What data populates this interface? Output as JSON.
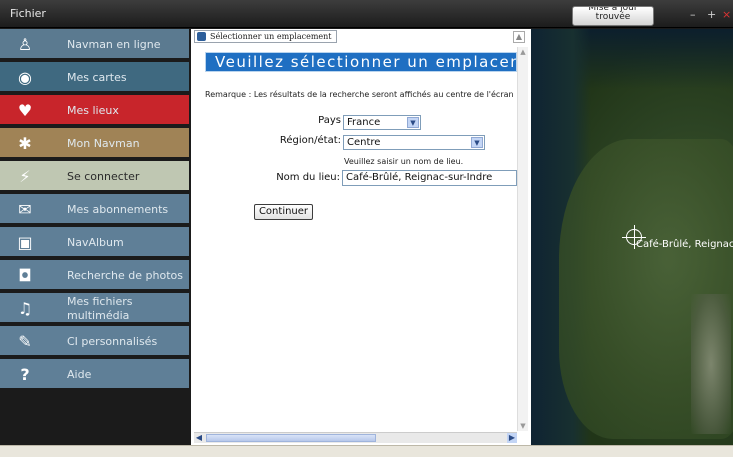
{
  "menu": {
    "fichier": "Fichier"
  },
  "update_button": "Mise à jour trouvée",
  "window_controls": [
    "–",
    "+",
    "×"
  ],
  "sidebar": {
    "items": [
      {
        "label": "Navman en ligne",
        "icon": "person-icon",
        "color": "#5b7a90"
      },
      {
        "label": "Mes cartes",
        "icon": "eye-icon",
        "color": "#3f6980"
      },
      {
        "label": "Mes lieux",
        "icon": "heart-icon",
        "color": "#c8252b"
      },
      {
        "label": "Mon Navman",
        "icon": "gear-icon",
        "color": "#a08356"
      },
      {
        "label": "Se connecter",
        "icon": "connect-icon",
        "color": "#bfc7b2"
      },
      {
        "label": "Mes abonnements",
        "icon": "envelope-icon",
        "color": "#5f7f97"
      },
      {
        "label": "NavAlbum",
        "icon": "album-icon",
        "color": "#5f7f97"
      },
      {
        "label": "Recherche de photos",
        "icon": "camera-icon",
        "color": "#5f7f97"
      },
      {
        "label": "Mes fichiers multimédia",
        "icon": "music-icon",
        "color": "#5f7f97"
      },
      {
        "label": "CI personnalisés",
        "icon": "poi-icon",
        "color": "#5f7f97"
      },
      {
        "label": "Aide",
        "icon": "help-icon",
        "color": "#5f7f97"
      }
    ]
  },
  "panel": {
    "tab_title": "Sélectionner un emplacement",
    "heading": "Veuillez sélectionner un emplacement",
    "remark": "Remarque : Les résultats de la recherche seront affichés au centre de l'écran",
    "country_label": "Pays",
    "country_value": "France",
    "region_label": "Région/état:",
    "region_value": "Centre",
    "place_hint": "Veuillez saisir un nom de lieu.",
    "place_label": "Nom du lieu:",
    "place_value": "Café-Brûlé, Reignac-sur-Indre",
    "continue_label": "Continuer"
  },
  "map": {
    "marker_label": "Café-Brûlé, Reignac-sur-Indre"
  }
}
